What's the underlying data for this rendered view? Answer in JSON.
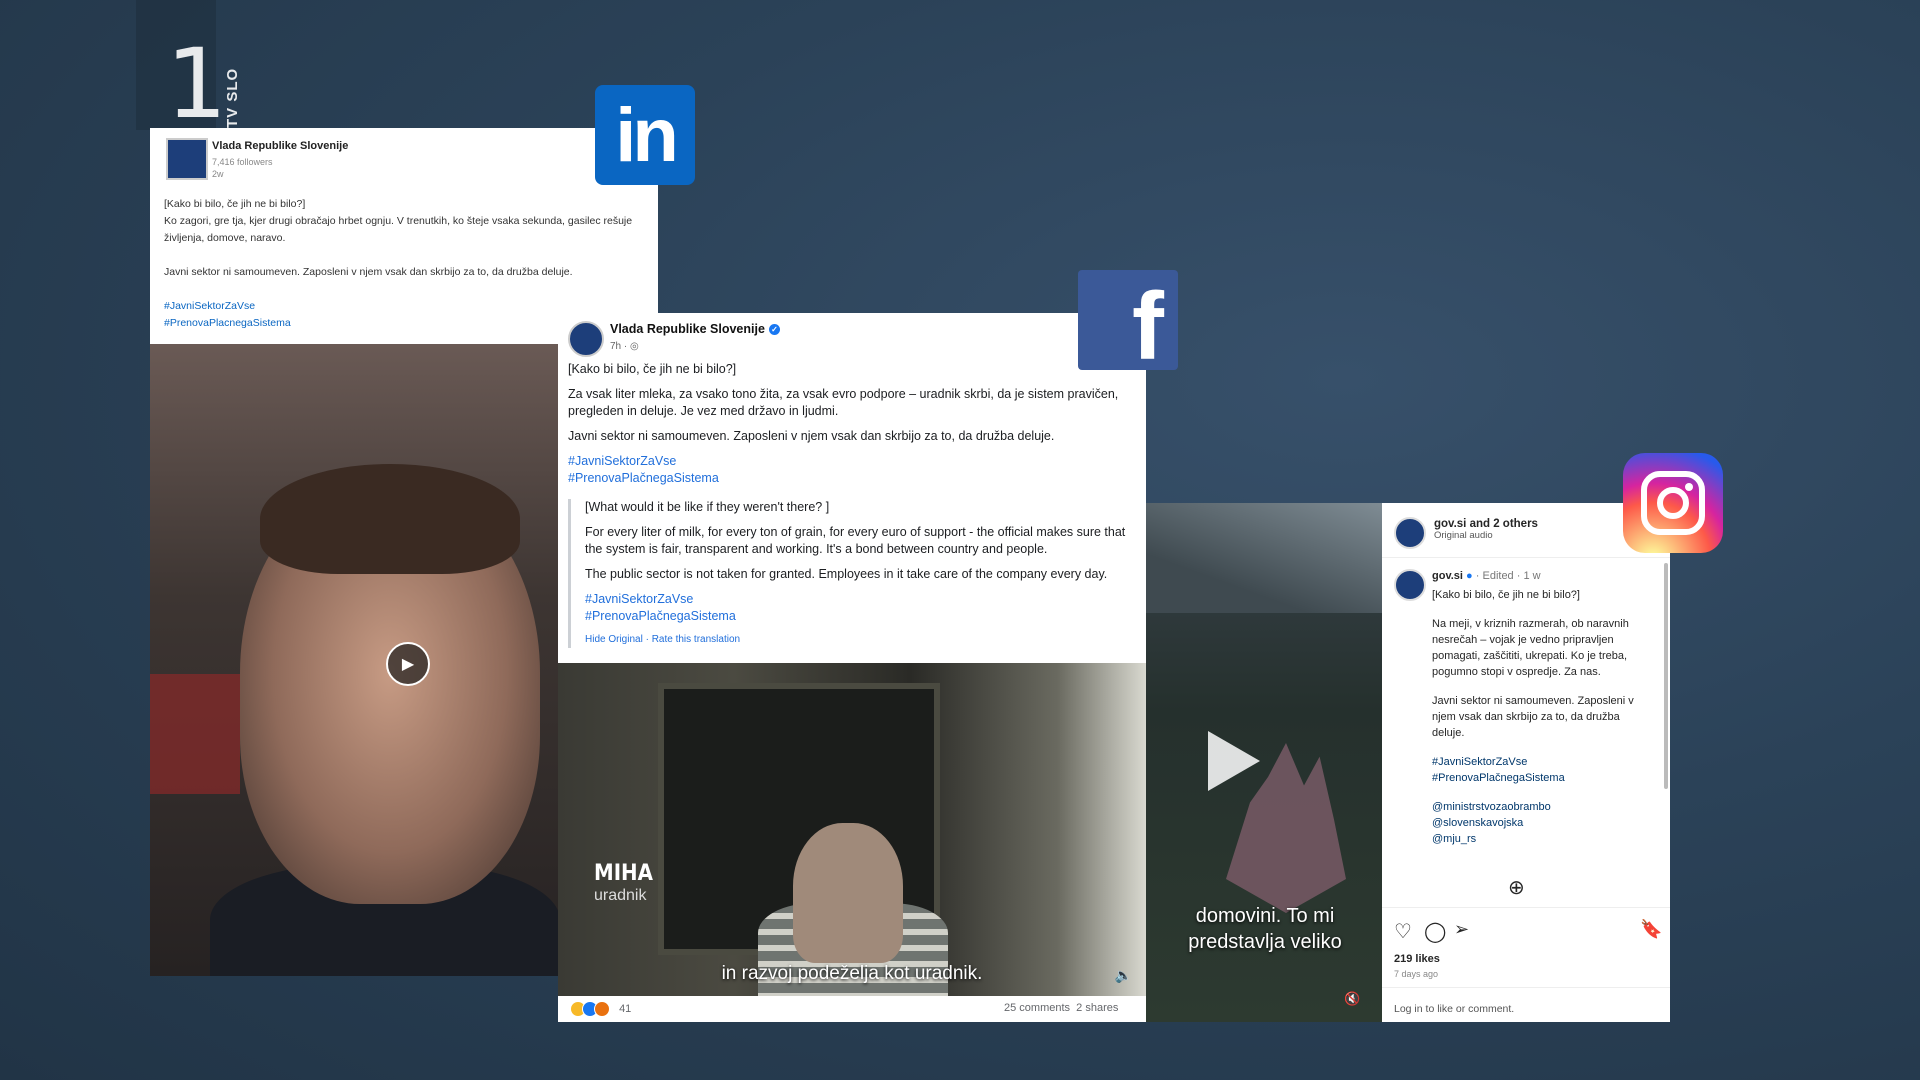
{
  "tv_logo": {
    "number": "1",
    "channel": "TV SLO"
  },
  "brands": {
    "linkedin": "in",
    "facebook": "f"
  },
  "linkedin_post": {
    "author": "Vlada Republike Slovenije",
    "followers": "7,416 followers",
    "time": "2w",
    "lines": [
      "[Kako bi bilo, če jih ne bi bilo?]",
      "Ko zagori, gre tja, kjer drugi obračajo hrbet ognju. V trenutkih, ko šteje vsaka sekunda, gasilec rešuje življenja, domove, naravo.",
      "Javni sektor ni samoumeven. Zaposleni v njem vsak dan skrbijo za to, da družba deluje."
    ],
    "tags": [
      "#JavniSektorZaVse",
      "#PrenovaPlacnegaSistema"
    ]
  },
  "facebook_post": {
    "author": "Vlada Republike Slovenije",
    "time": "7h · ◎",
    "heading": "[Kako bi bilo, če jih ne bi bilo?]",
    "para1": "Za vsak liter mleka, za vsako tono žita, za vsak evro podpore – uradnik skrbi, da je sistem pravičen, pregleden in deluje. Je vez med državo in ljudmi.",
    "para2": "Javni sektor ni samoumeven. Zaposleni v njem vsak dan skrbijo za to, da družba deluje.",
    "tags": [
      "#JavniSektorZaVse",
      "#PrenovaPlačnegaSistema"
    ],
    "translation": {
      "heading": "[What would it be like if they weren't there? ]",
      "para1": "For every liter of milk, for every ton of grain, for every euro of support - the official makes sure that the system is fair, transparent and working. It's a bond between country and people.",
      "para2": "The public sector is not taken for granted. Employees in it take care of the company every day.",
      "tags": [
        "#JavniSektorZaVse",
        "#PrenovaPlačnegaSistema"
      ],
      "links": "Hide Original · Rate this translation"
    },
    "video": {
      "name": "MIHA",
      "role": "uradnik",
      "subtitle": "in razvoj podeželja kot uradnik."
    },
    "footer": {
      "reactions": "41",
      "comments": "25 comments",
      "shares": "2 shares"
    }
  },
  "instagram_post": {
    "header_name": "gov.si and 2 others",
    "header_sub": "Original audio",
    "author": "gov.si",
    "meta": "· Edited · 1 w",
    "heading": "[Kako bi bilo, če jih ne bi bilo?]",
    "para1": "Na meji, v kriznih razmerah, ob naravnih nesrečah – vojak je vedno pripravljen pomagati, zaščititi, ukrepati. Ko je treba, pogumno stopi v ospredje. Za nas.",
    "para2": "Javni sektor ni samoumeven. Zaposleni v njem vsak dan skrbijo za to, da družba deluje.",
    "tags": [
      "#JavniSektorZaVse",
      "#PrenovaPlačnegaSistema"
    ],
    "mentions": [
      "@ministrstvozaobrambo",
      "@slovenskavojska",
      "@mju_rs"
    ],
    "likes": "219 likes",
    "ago": "7 days ago",
    "login": "Log in to like or comment.",
    "video_subtitle": "domovini. To mi predstavlja veliko"
  },
  "colors": {
    "linkedin": "#0a66c2",
    "facebook": "#3b5998",
    "link": "#216fdb"
  }
}
